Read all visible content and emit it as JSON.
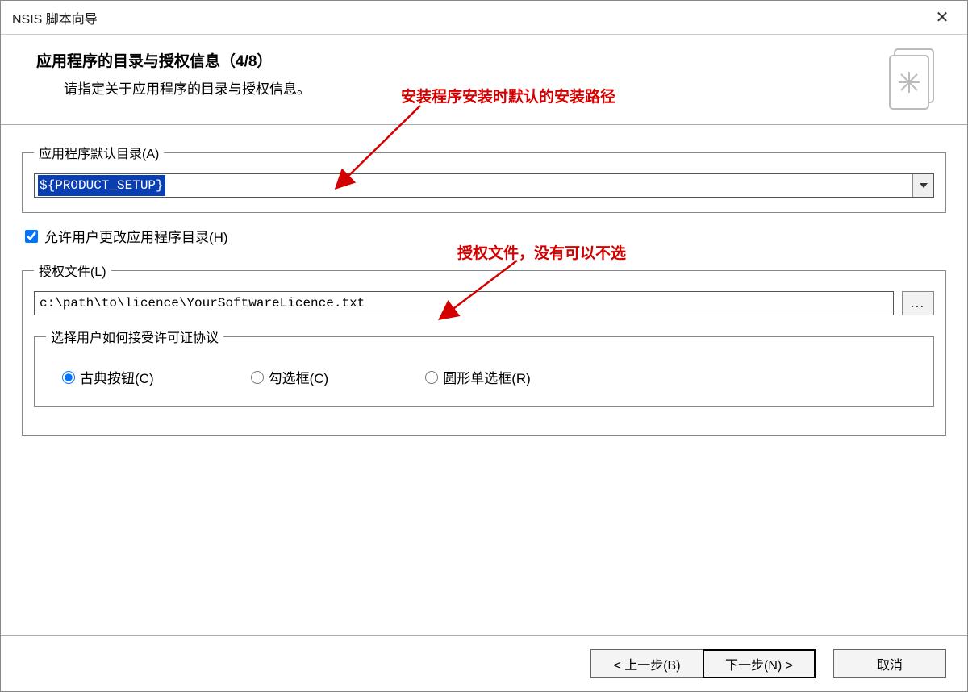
{
  "window": {
    "title": "NSIS 脚本向导",
    "close_symbol": "✕"
  },
  "header": {
    "title": "应用程序的目录与授权信息（4/8）",
    "subtitle": "请指定关于应用程序的目录与授权信息。"
  },
  "annotations": {
    "install_path": "安装程序安装时默认的安装路径",
    "license_file": "授权文件，没有可以不选"
  },
  "default_dir": {
    "legend": "应用程序默认目录(A)",
    "value": "${PRODUCT_SETUP}"
  },
  "allow_change": {
    "label": "允许用户更改应用程序目录(H)",
    "checked": true
  },
  "license": {
    "legend": "授权文件(L)",
    "path": "c:\\path\\to\\licence\\YourSoftwareLicence.txt",
    "browse_label": "...",
    "agreement_legend": "选择用户如何接受许可证协议",
    "options": {
      "classic": "古典按钮(C)",
      "checkbox": "勾选框(C)",
      "radio": "圆形单选框(R)"
    },
    "selected": "classic"
  },
  "buttons": {
    "back": "< 上一步(B)",
    "next": "下一步(N) >",
    "cancel": "取消"
  }
}
